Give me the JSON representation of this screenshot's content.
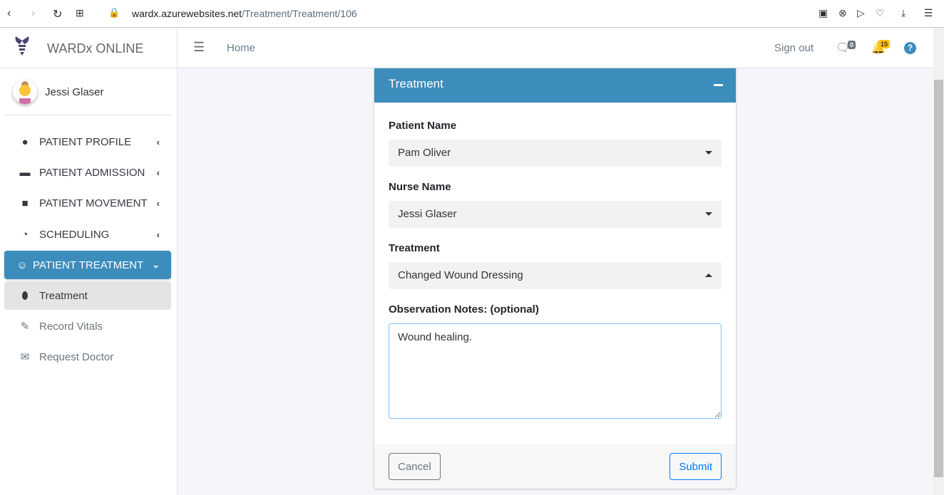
{
  "browser": {
    "url_domain": "wardx.azurewebsites.net",
    "url_path": "/Treatment/Treatment/106"
  },
  "brand": {
    "name": "WARDx ONLINE"
  },
  "user": {
    "name": "Jessi Glaser"
  },
  "nav": [
    {
      "label": "PATIENT PROFILE"
    },
    {
      "label": "PATIENT ADMISSION"
    },
    {
      "label": "PATIENT MOVEMENT"
    },
    {
      "label": "SCHEDULING"
    },
    {
      "label": "PATIENT TREATMENT"
    }
  ],
  "subnav": [
    {
      "label": "Treatment"
    },
    {
      "label": "Record Vitals"
    },
    {
      "label": "Request Doctor"
    }
  ],
  "header": {
    "home": "Home",
    "sign_out": "Sign out",
    "messages_count": "0",
    "notifications_count": "15"
  },
  "card": {
    "title": "Treatment",
    "patient_label": "Patient Name",
    "patient_value": "Pam Oliver",
    "nurse_label": "Nurse Name",
    "nurse_value": "Jessi Glaser",
    "treatment_label": "Treatment",
    "treatment_value": "Changed Wound Dressing",
    "notes_label": "Observation Notes: (optional)",
    "notes_value": "Wound healing.",
    "cancel": "Cancel",
    "submit": "Submit"
  },
  "colors": {
    "primary": "#3c8dbc",
    "submit": "#007bff",
    "badge_warning": "#ffc107"
  }
}
